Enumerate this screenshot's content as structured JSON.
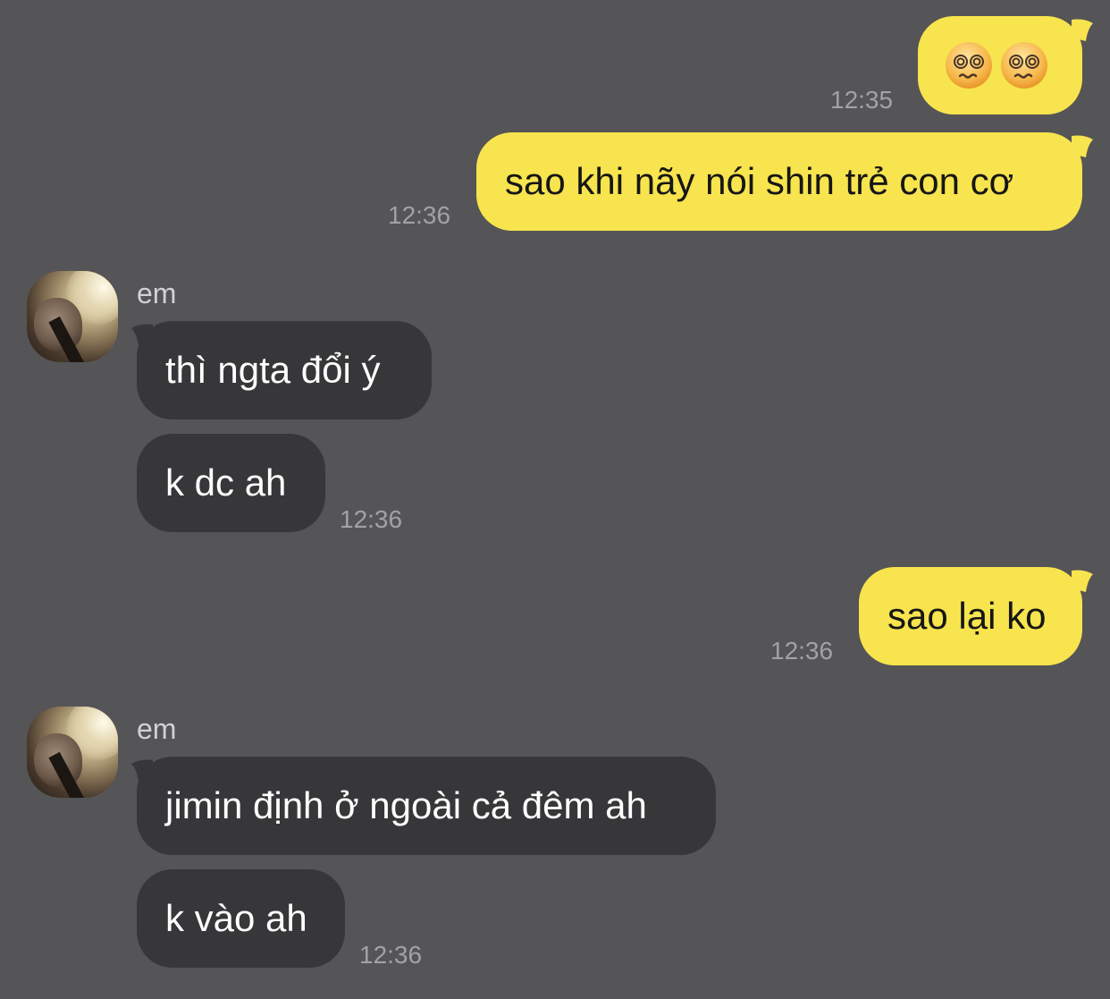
{
  "messages": [
    {
      "direction": "out",
      "emojis": [
        "dizzy-face",
        "dizzy-face"
      ],
      "time": "12:35"
    },
    {
      "direction": "out",
      "text": "sao khi nãy nói shin trẻ con cơ",
      "time": "12:36"
    },
    {
      "direction": "in",
      "sender": "em",
      "text": "thì ngta đổi ý"
    },
    {
      "direction": "in",
      "text": "k dc ah",
      "time": "12:36"
    },
    {
      "direction": "out",
      "text": "sao lại ko",
      "time": "12:36"
    },
    {
      "direction": "in",
      "sender": "em",
      "text": "jimin định ở ngoài cả đêm ah"
    },
    {
      "direction": "in",
      "text": "k vào ah",
      "time": "12:36"
    }
  ],
  "colors": {
    "background": "#555456",
    "outgoing_bubble": "#f7e44e",
    "incoming_bubble": "#373638",
    "timestamp": "#a3a1a4"
  }
}
